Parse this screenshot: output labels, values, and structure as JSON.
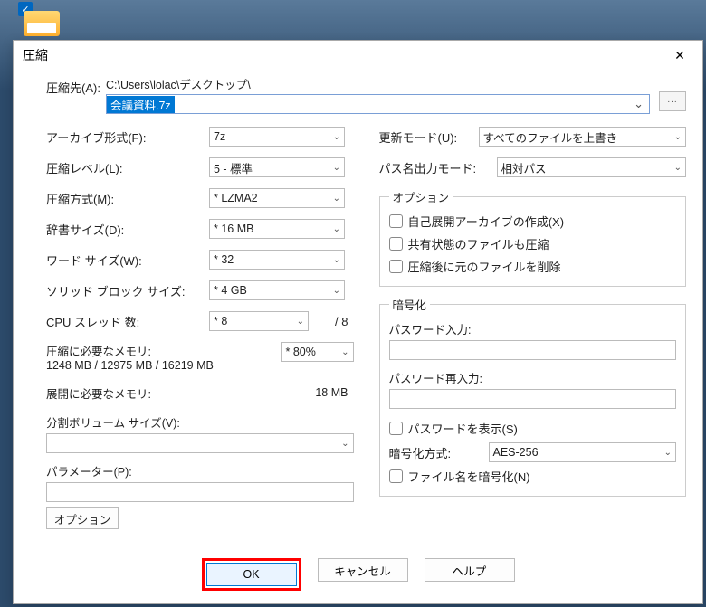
{
  "dialog": {
    "title": "圧縮"
  },
  "path": {
    "label": "圧縮先(A):",
    "directory": "C:\\Users\\lolac\\デスクトップ\\",
    "filename": "会議資料.7z",
    "browse": "..."
  },
  "left": {
    "format": {
      "label": "アーカイブ形式(F):",
      "value": "7z"
    },
    "level": {
      "label": "圧縮レベル(L):",
      "value": "5 - 標準"
    },
    "method": {
      "label": "圧縮方式(M):",
      "value": "* LZMA2"
    },
    "dict": {
      "label": "辞書サイズ(D):",
      "value": "* 16 MB"
    },
    "word": {
      "label": "ワード サイズ(W):",
      "value": "* 32"
    },
    "solid": {
      "label": "ソリッド ブロック サイズ:",
      "value": "* 4 GB"
    },
    "threads": {
      "label": "CPU スレッド 数:",
      "value": "* 8",
      "max": "/ 8"
    },
    "mem_compress": {
      "label": "圧縮に必要なメモリ:",
      "value": "1248 MB / 12975 MB / 16219 MB",
      "pct": "* 80%"
    },
    "mem_decompress": {
      "label": "展開に必要なメモリ:",
      "value": "18 MB"
    },
    "split": {
      "label": "分割ボリューム サイズ(V):"
    },
    "params": {
      "label": "パラメーター(P):"
    },
    "option_btn": "オプション"
  },
  "right": {
    "update": {
      "label": "更新モード(U):",
      "value": "すべてのファイルを上書き"
    },
    "pathmode": {
      "label": "パス名出力モード:",
      "value": "相対パス"
    },
    "options": {
      "legend": "オプション",
      "sfx": "自己展開アーカイブの作成(X)",
      "shared": "共有状態のファイルも圧縮",
      "delete": "圧縮後に元のファイルを削除"
    },
    "enc": {
      "legend": "暗号化",
      "pw": "パスワード入力:",
      "pw2": "パスワード再入力:",
      "show": "パスワードを表示(S)",
      "method_label": "暗号化方式:",
      "method": "AES-256",
      "encnames": "ファイル名を暗号化(N)"
    }
  },
  "buttons": {
    "ok": "OK",
    "cancel": "キャンセル",
    "help": "ヘルプ"
  }
}
